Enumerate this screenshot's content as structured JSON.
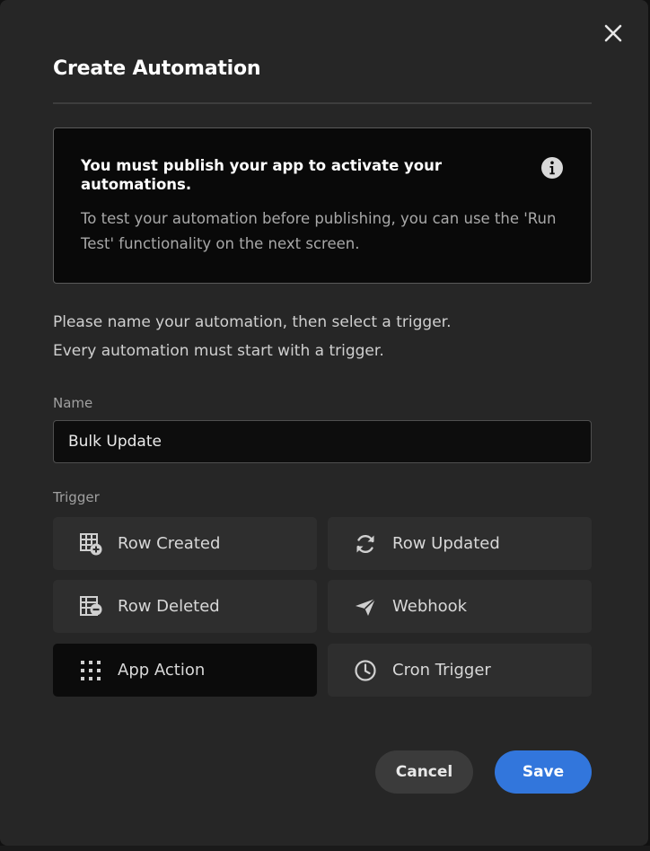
{
  "modal": {
    "title": "Create Automation",
    "notice": {
      "heading": "You must publish your app to activate your automations.",
      "body": "To test your automation before publishing, you can use the 'Run Test' functionality on the next screen.",
      "icon": "info-icon"
    },
    "intro_line1": "Please name your automation, then select a trigger.",
    "intro_line2": "Every automation must start with a trigger.",
    "name_field": {
      "label": "Name",
      "value": "Bulk Update"
    },
    "trigger_section": {
      "label": "Trigger",
      "selected": "App Action",
      "options": [
        {
          "label": "Row Created",
          "icon": "table-plus-icon"
        },
        {
          "label": "Row Updated",
          "icon": "refresh-icon"
        },
        {
          "label": "Row Deleted",
          "icon": "table-minus-icon"
        },
        {
          "label": "Webhook",
          "icon": "paper-plane-icon"
        },
        {
          "label": "App Action",
          "icon": "grid-dots-icon"
        },
        {
          "label": "Cron Trigger",
          "icon": "clock-icon"
        }
      ]
    },
    "buttons": {
      "cancel": "Cancel",
      "save": "Save"
    }
  },
  "colors": {
    "modal_background": "#262626",
    "notice_background": "#090909",
    "trigger_background": "#2e2e2e",
    "trigger_selected_background": "#0b0b0b",
    "primary_button": "#3276dc",
    "secondary_button": "#3b3b3b"
  }
}
